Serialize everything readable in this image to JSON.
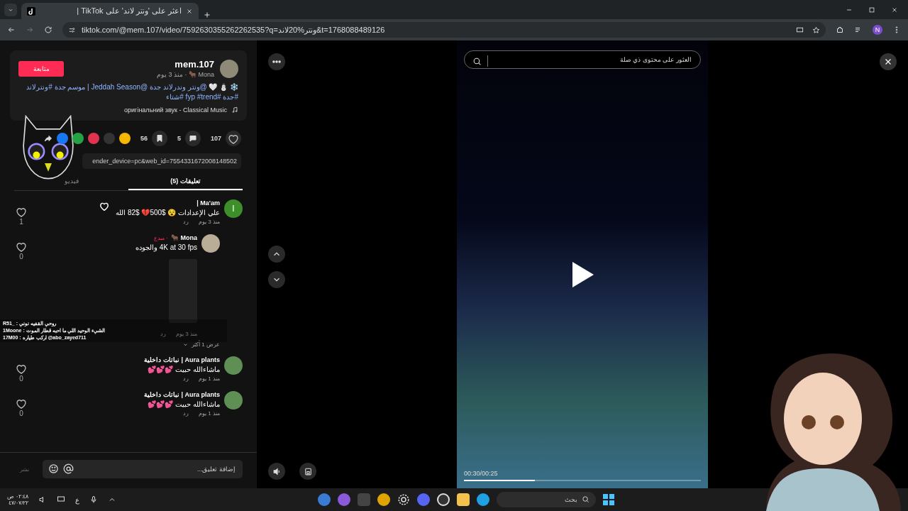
{
  "browser": {
    "tab": {
      "title": "اعثر على 'ونتر لاند' على TikTok |",
      "selected": true
    },
    "url": "tiktok.com/@mem.107/video/7592630355262262535?q=ونتر%20لاند&t=1768088489126",
    "profile_initial": "N"
  },
  "post": {
    "author": "mem.107",
    "info": "Mona 🐂 · منذ 3 يوم",
    "follow_label": "متابعة",
    "description": "❄️ ⛄ 🤍 @ونتر وندرلاند جدة @Jeddah Season | موسم جدة #ونترلاند #جدة #fyp #trend #شتاء",
    "music": "оригінальний звук - Classical Music",
    "likes": "107",
    "comments": "5",
    "saves": "56",
    "link": "ender_device=pc&web_id=7554331672008148502"
  },
  "tabs": [
    {
      "label": "تعليقات (5)",
      "selected": true
    },
    {
      "label": "فيديو",
      "selected": false
    }
  ],
  "comments": [
    {
      "author": "Ma'am |",
      "avatar_letter": "I",
      "text": "علي الإعدادات 😵 $500💔 $82 الله",
      "time": "منذ 3 يوم",
      "reply": "رد",
      "likes": "1",
      "replies": [
        {
          "author": "Mona 🐂",
          "badge": "· مبدع",
          "text": "4K at 30 fps والجوده",
          "time": "منذ 3 يوم",
          "reply": "رد",
          "likes": "0",
          "has_image": true
        }
      ],
      "more": "عرض 1 أكثر"
    },
    {
      "author": "Aura plants | نباتات داخلية",
      "text": "ماشاءالله حبيت 💕💕💕",
      "time": "منذ 1 يوم",
      "reply": "رد",
      "likes": "0"
    },
    {
      "author": "Aura plants | نباتات داخلية",
      "text": "ماشاءالله حبيت 💕💕💕",
      "time": "منذ 1 يوم",
      "reply": "رد",
      "likes": "0"
    }
  ],
  "stream_chat": [
    "R51_ : روحي القفيه نوني",
    "1Moone : الشيء الوحيد اللي ما احبه قطار الموت",
    "17M00 : اركب طياره @abo_zayed711"
  ],
  "comment_input": {
    "placeholder": "إضافة تعليق...",
    "post_label": "نشر",
    "disabled": true
  },
  "player": {
    "search_placeholder": "العثور على محتوى ذي صلة",
    "time": "00:30/00:25",
    "level": 0.3
  },
  "taskbar": {
    "search_placeholder": "بحث",
    "language": "ع",
    "time": "٠٢:٤٨ ص",
    "date": "٤٧/٠٧/٢٢"
  }
}
